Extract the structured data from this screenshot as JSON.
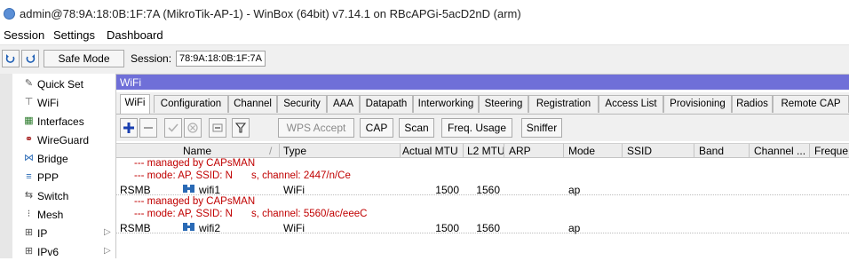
{
  "window": {
    "title": "admin@78:9A:18:0B:1F:7A (MikroTik-AP-1) - WinBox (64bit) v7.14.1 on RBcAPGi-5acD2nD (arm)",
    "logo_icon": "winbox-logo-icon"
  },
  "menu": [
    "Session",
    "Settings",
    "Dashboard"
  ],
  "toolbar": {
    "undo_icon": "undo-icon",
    "redo_icon": "redo-icon",
    "safe_mode_label": "Safe Mode",
    "session_label": "Session:",
    "session_value": "78:9A:18:0B:1F:7A"
  },
  "sidebar": {
    "items": [
      {
        "label": "Quick Set",
        "icon": "wand-icon",
        "glyph": "✎"
      },
      {
        "label": "WiFi",
        "icon": "wifi-icon",
        "glyph": "⊤"
      },
      {
        "label": "Interfaces",
        "icon": "interfaces-icon",
        "glyph": "▦"
      },
      {
        "label": "WireGuard",
        "icon": "wireguard-icon",
        "glyph": "⚭"
      },
      {
        "label": "Bridge",
        "icon": "bridge-icon",
        "glyph": "⋈"
      },
      {
        "label": "PPP",
        "icon": "ppp-icon",
        "glyph": "≡"
      },
      {
        "label": "Switch",
        "icon": "switch-icon",
        "glyph": "⇆"
      },
      {
        "label": "Mesh",
        "icon": "mesh-icon",
        "glyph": "⁝"
      },
      {
        "label": "IP",
        "icon": "ip-icon",
        "glyph": "⊞"
      },
      {
        "label": "IPv6",
        "icon": "ipv6-icon",
        "glyph": "⊞"
      }
    ],
    "submenu_arrow": "▷"
  },
  "wifi_window": {
    "title": "WiFi",
    "tabs": [
      "WiFi",
      "Configuration",
      "Channel",
      "Security",
      "AAA",
      "Datapath",
      "Interworking",
      "Steering",
      "Registration",
      "Access List",
      "Provisioning",
      "Radios",
      "Remote CAP"
    ],
    "active_tab": "WiFi",
    "actions": {
      "add_icon": "plus-icon",
      "remove_icon": "minus-icon",
      "enable_icon": "check-icon",
      "disable_icon": "cross-icon",
      "comment_icon": "comment-icon",
      "filter_icon": "filter-icon",
      "wps_accept": "WPS Accept",
      "cap": "CAP",
      "scan": "Scan",
      "freq_usage": "Freq. Usage",
      "sniffer": "Sniffer"
    },
    "columns": [
      "Name",
      "Type",
      "Actual MTU",
      "L2 MTU",
      "ARP",
      "Mode",
      "SSID",
      "Band",
      "Channel ...",
      "Freque"
    ],
    "sort_glyph": "/",
    "rows": [
      {
        "comment1": "--- managed by CAPsMAN",
        "comment2": "--- mode: AP, SSID: N",
        "comment2b": "s, channel: 2447/n/Ce",
        "flags": "RSMB",
        "name": "wifi1",
        "type": "WiFi",
        "actual_mtu": "1500",
        "l2_mtu": "1560",
        "mode": "ap"
      },
      {
        "comment1": "--- managed by CAPsMAN",
        "comment2": "--- mode: AP, SSID: N",
        "comment2b": "s, channel: 5560/ac/eeeC",
        "flags": "RSMB",
        "name": "wifi2",
        "type": "WiFi",
        "actual_mtu": "1500",
        "l2_mtu": "1560",
        "mode": "ap"
      }
    ]
  }
}
